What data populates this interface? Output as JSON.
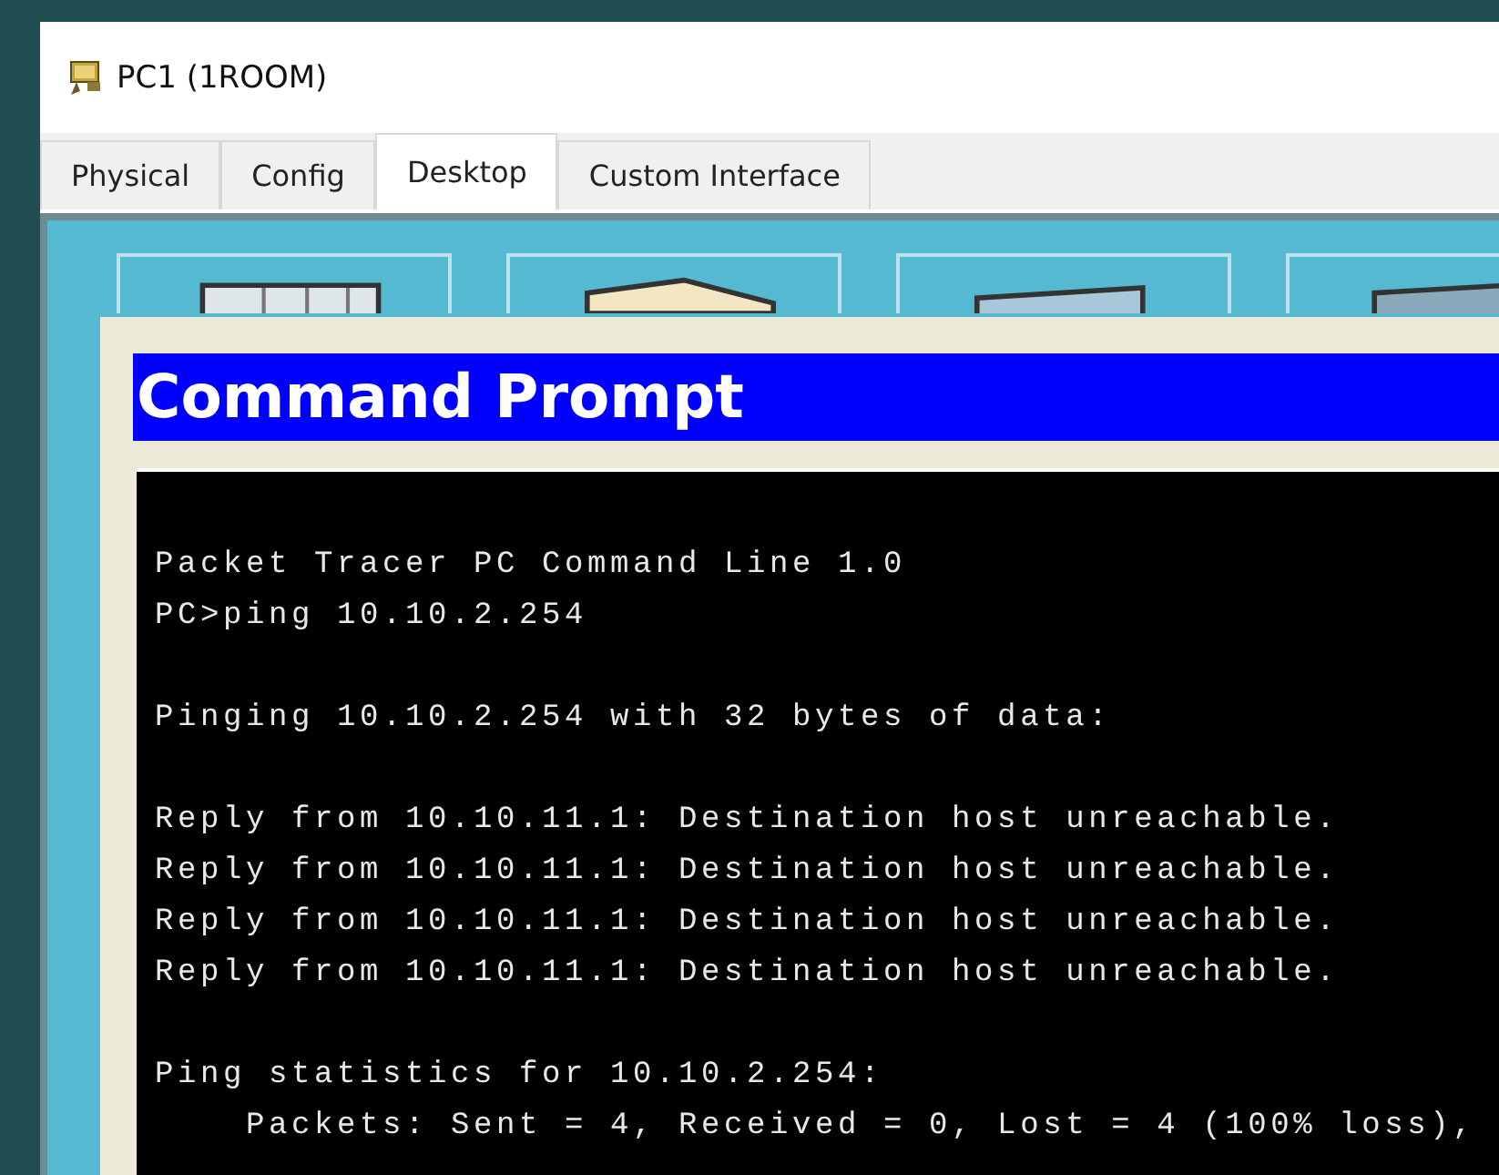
{
  "window": {
    "title": "PC1 (1ROOM)"
  },
  "tabs": [
    {
      "label": "Physical",
      "selected": false
    },
    {
      "label": "Config",
      "selected": false
    },
    {
      "label": "Desktop",
      "selected": true
    },
    {
      "label": "Custom Interface",
      "selected": false
    }
  ],
  "command_prompt": {
    "title": "Command Prompt",
    "blocks": [
      [
        "Packet Tracer PC Command Line 1.0",
        "PC>ping 10.10.2.254"
      ],
      [
        "Pinging 10.10.2.254 with 32 bytes of data:"
      ],
      [
        "Reply from 10.10.11.1: Destination host unreachable.",
        "Reply from 10.10.11.1: Destination host unreachable.",
        "Reply from 10.10.11.1: Destination host unreachable.",
        "Reply from 10.10.11.1: Destination host unreachable."
      ],
      [
        "Ping statistics for 10.10.2.254:",
        "    Packets: Sent = 4, Received = 0, Lost = 4 (100% loss),"
      ]
    ]
  }
}
